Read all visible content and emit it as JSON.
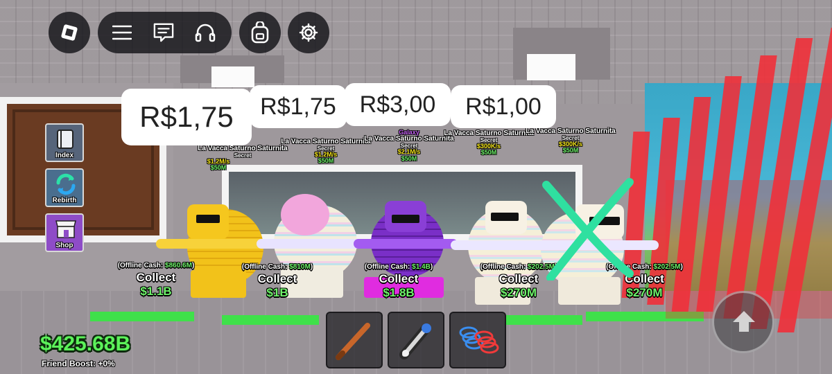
{
  "topbar": {
    "icons": [
      "roblox-logo-icon",
      "hamburger-menu-icon",
      "chat-icon",
      "headset-icon",
      "backpack-icon",
      "gear-icon"
    ]
  },
  "side_menu": [
    {
      "label": "Index",
      "icon": "book-icon",
      "color": "#56647a"
    },
    {
      "label": "Rebirth",
      "icon": "refresh-icon",
      "color": "#4a6e8e"
    },
    {
      "label": "Shop",
      "icon": "store-icon",
      "color": "#8e4cc7"
    }
  ],
  "price_overlays": [
    "R$1,75",
    "R$1,75",
    "R$3,00",
    "R$1,00"
  ],
  "stands": [
    {
      "name": "La Vacca Saturno Saturnita",
      "rarity": "Secret",
      "tier": "",
      "rate": "$1.2M/s",
      "price": "$50M",
      "offline_label": "(Offline Cash: ",
      "offline_amount": "$860.6M",
      "offline_close": ")",
      "collect": "Collect",
      "amount": "$1.1B"
    },
    {
      "name": "La Vacca Saturno Saturnita",
      "rarity": "Secret",
      "tier": "",
      "rate": "$1.2M/s",
      "price": "$50M",
      "offline_label": "(Offline Cash: ",
      "offline_amount": "$810M",
      "offline_close": ")",
      "collect": "Collect",
      "amount": "$1B"
    },
    {
      "name": "La Vacca Saturno Saturnita",
      "rarity": "Secret",
      "tier": "Galaxy",
      "rate": "$2.1M/s",
      "price": "$50M",
      "offline_label": "(Offline Cash: ",
      "offline_amount": "$1.4B",
      "offline_close": ")",
      "collect": "Collect",
      "amount": "$1.8B"
    },
    {
      "name": "La Vacca Saturno Saturnita",
      "rarity": "Secret",
      "tier": "",
      "rate": "$300K/s",
      "price": "$50M",
      "offline_label": "(Offline Cash: ",
      "offline_amount": "$202.5M",
      "offline_close": ")",
      "collect": "Collect",
      "amount": "$270M"
    },
    {
      "name": "La Vacca Saturno Saturnita",
      "rarity": "Secret",
      "tier": "",
      "rate": "$300K/s",
      "price": "$50M",
      "offline_label": "(Offline Cash: ",
      "offline_amount": "$202.5M",
      "offline_close": ")",
      "collect": "Collect",
      "amount": "$270M"
    }
  ],
  "hotbar": [
    {
      "icon": "baseball-bat-icon"
    },
    {
      "icon": "grapple-gun-icon"
    },
    {
      "icon": "speed-coil-icon"
    }
  ],
  "wallet": {
    "cash": "$425.68B",
    "friend_boost": "Friend Boost: +0%"
  },
  "colors": {
    "cash_green": "#5cf25a",
    "overlay_x": "#2fe0a0",
    "laser_red": "#f0303a"
  }
}
